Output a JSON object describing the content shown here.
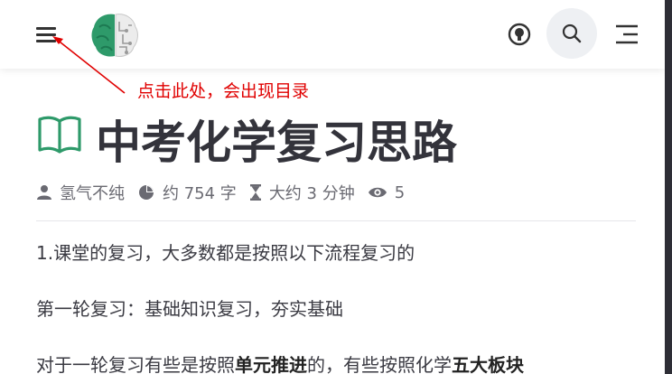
{
  "annotation": {
    "text": "点击此处，会出现目录"
  },
  "article": {
    "title": "中考化学复习思路",
    "meta": {
      "author": "氢气不纯",
      "word_count": "约 754 字",
      "read_time": "大约 3 分钟",
      "views": "5"
    },
    "paragraphs": {
      "p1": "1.课堂的复习，大多数都是按照以下流程复习的",
      "p2": "第一轮复习：基础知识复习，夯实基础",
      "p3_a": "对于一轮复习有些是按照",
      "p3_b": "单元推进",
      "p3_c": "的，有些按照化学",
      "p3_d": "五大板块"
    }
  },
  "colors": {
    "annotation": "#e00000",
    "brand_green": "#2e9a6a",
    "title": "#33333b"
  },
  "icons": {
    "menu": "menu-icon",
    "logo": "brain-logo",
    "theme": "bulb-icon",
    "search": "search-icon",
    "toc": "toc-icon",
    "book": "book-icon",
    "author": "user-icon",
    "words": "pie-chart-icon",
    "time": "hourglass-icon",
    "views": "eye-icon"
  }
}
